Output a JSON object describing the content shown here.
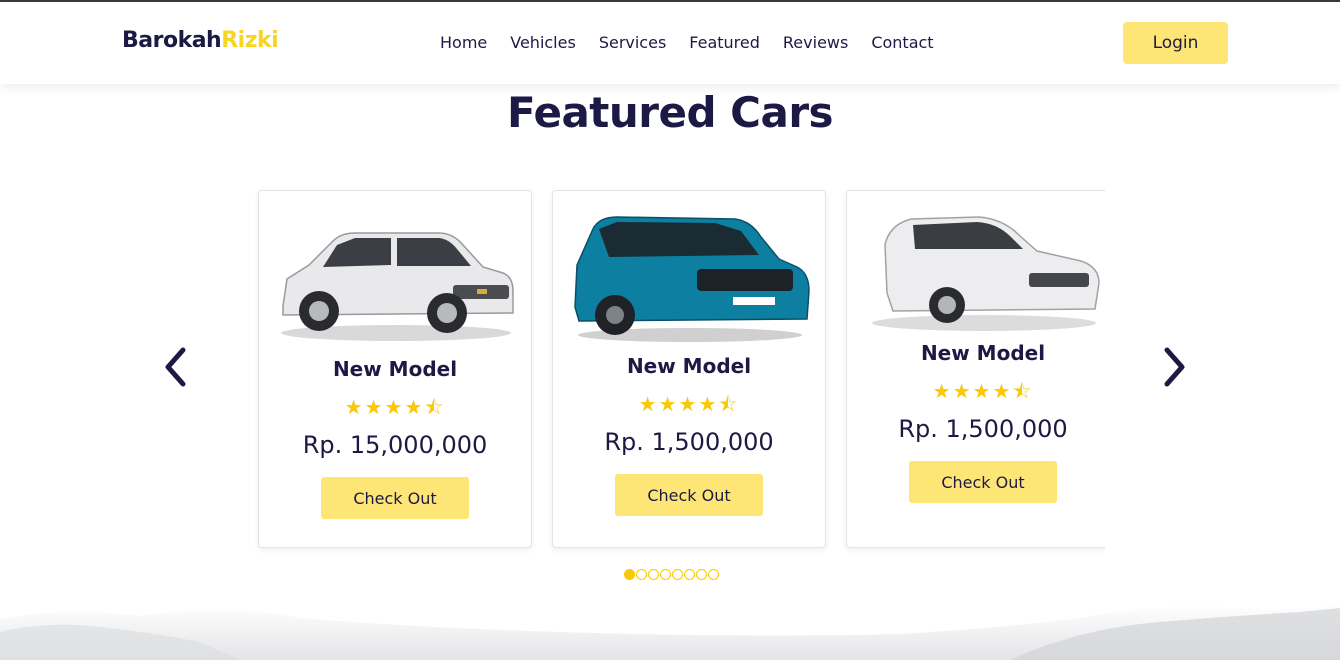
{
  "brand": {
    "part1": "Barokah",
    "part2": "Rizki"
  },
  "nav": {
    "items": [
      "Home",
      "Vehicles",
      "Services",
      "Featured",
      "Reviews",
      "Contact"
    ]
  },
  "header": {
    "login_label": "Login"
  },
  "section": {
    "title_highlight": "Featured",
    "title_rest": " Cars"
  },
  "cards": [
    {
      "name": "New Model",
      "rating": 4.5,
      "stars": "★★★★⯪",
      "price": "Rp. 15,000,000",
      "button": "Check Out",
      "car_color": "#e8e8ea",
      "car_icon": "white-suv-image"
    },
    {
      "name": "New Model",
      "rating": 4.5,
      "stars": "★★★★⯪",
      "price": "Rp. 1,500,000",
      "button": "Check Out",
      "car_color": "#0d7fa0",
      "car_icon": "blue-suv-image"
    },
    {
      "name": "New Model",
      "rating": 4.5,
      "stars": "★★★★⯪",
      "price": "Rp. 1,500,000",
      "button": "Check Out",
      "car_color": "#ededef",
      "car_icon": "white-sedan-image"
    }
  ],
  "carousel": {
    "dot_count": 8,
    "active_dot": 0,
    "prev_icon": "chevron-left-icon",
    "next_icon": "chevron-right-icon"
  },
  "colors": {
    "accent": "#f8d51e",
    "button": "#fde676",
    "text": "#1c1a45"
  }
}
